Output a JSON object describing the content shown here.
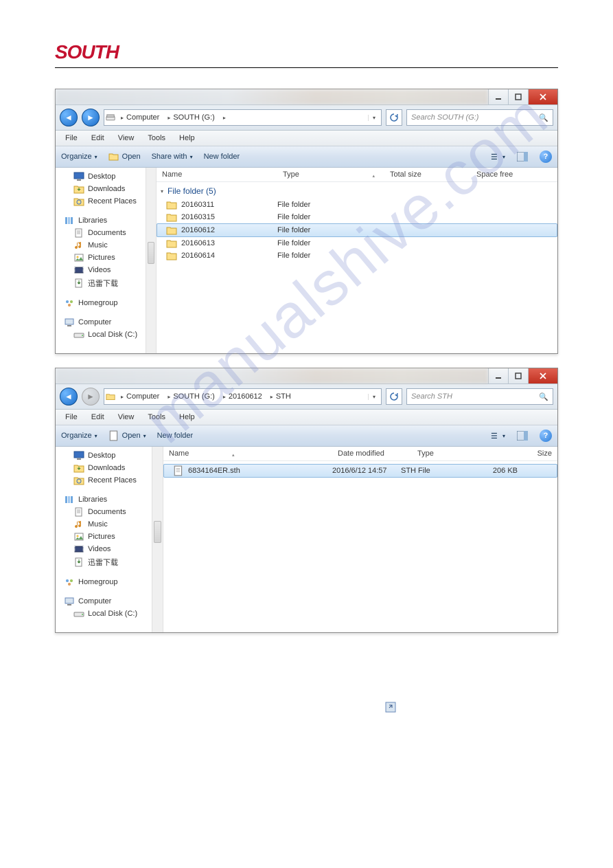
{
  "logo": "SOUTH",
  "windows": [
    {
      "breadcrumb": [
        "Computer",
        "SOUTH (G:)"
      ],
      "search_placeholder": "Search SOUTH (G:)",
      "menu": [
        "File",
        "Edit",
        "View",
        "Tools",
        "Help"
      ],
      "toolbar": {
        "organize": "Organize",
        "open": "Open",
        "share": "Share with",
        "newfolder": "New folder"
      },
      "columns": {
        "name": "Name",
        "type": "Type",
        "total": "Total size",
        "free": "Space free"
      },
      "group_label": "File folder (5)",
      "rows": [
        {
          "name": "20160311",
          "type": "File folder"
        },
        {
          "name": "20160315",
          "type": "File folder"
        },
        {
          "name": "20160612",
          "type": "File folder",
          "selected": true
        },
        {
          "name": "20160613",
          "type": "File folder"
        },
        {
          "name": "20160614",
          "type": "File folder"
        }
      ],
      "tree": {
        "desktop": "Desktop",
        "downloads": "Downloads",
        "recent": "Recent Places",
        "libraries": "Libraries",
        "documents": "Documents",
        "music": "Music",
        "pictures": "Pictures",
        "videos": "Videos",
        "xunlei": "迅雷下载",
        "homegroup": "Homegroup",
        "computer": "Computer",
        "localc": "Local Disk (C:)"
      }
    },
    {
      "breadcrumb": [
        "Computer",
        "SOUTH (G:)",
        "20160612",
        "STH"
      ],
      "search_placeholder": "Search STH",
      "menu": [
        "File",
        "Edit",
        "View",
        "Tools",
        "Help"
      ],
      "toolbar": {
        "organize": "Organize",
        "open": "Open",
        "newfolder": "New folder"
      },
      "columns": {
        "name": "Name",
        "modified": "Date modified",
        "type": "Type",
        "size": "Size"
      },
      "rows": [
        {
          "name": "6834164ER.sth",
          "modified": "2016/6/12 14:57",
          "type": "STH File",
          "size": "206 KB",
          "selected": true
        }
      ],
      "tree": {
        "desktop": "Desktop",
        "downloads": "Downloads",
        "recent": "Recent Places",
        "libraries": "Libraries",
        "documents": "Documents",
        "music": "Music",
        "pictures": "Pictures",
        "videos": "Videos",
        "xunlei": "迅雷下载",
        "homegroup": "Homegroup",
        "computer": "Computer",
        "localc": "Local Disk (C:)"
      }
    }
  ],
  "watermark": "manualshive.com"
}
